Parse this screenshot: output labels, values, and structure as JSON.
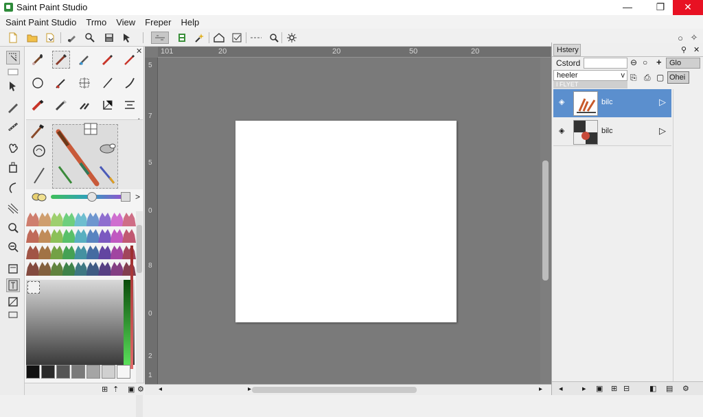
{
  "window": {
    "title": "Saint Paint Studio",
    "minimize": "—",
    "maximize": "❐",
    "close": "✕"
  },
  "menu": [
    "Saint Paint Studio",
    "Trmo",
    "View",
    "Freper",
    "Help"
  ],
  "toolbar": {
    "buttons": [
      "new-file-icon",
      "open-folder-icon",
      "import-icon",
      "brush-settings-icon",
      "zoom-tool-icon",
      "save-icon",
      "pointer-icon",
      "select-active-icon",
      "layer-icon",
      "effects-icon",
      "home-icon",
      "check-icon",
      "dots-icon",
      "search-icon",
      "settings-gear-icon"
    ],
    "right_icons": [
      "○",
      "✧"
    ]
  },
  "ruler": {
    "h_ticks": [
      "101",
      "20",
      "20",
      "50",
      "20"
    ],
    "v_ticks": [
      "5",
      "7",
      "5",
      "0",
      "8",
      "0",
      "2",
      "1"
    ]
  },
  "panel": {
    "close": "✕",
    "collapse": "^",
    "slider_arrow": ">",
    "slider_value": 0.6
  },
  "right": {
    "tab": "Hstery",
    "pin": "⚲",
    "close": "✕",
    "cstord_label": "Cstord",
    "blend_value": "",
    "opacity_value": "Glo",
    "filter_label": "heeler",
    "filter_dropdown": "v",
    "layer_group": "I FLYET",
    "opt_label": "Ohei",
    "layers": [
      {
        "name": "bilc",
        "selected": true
      },
      {
        "name": "bilc",
        "selected": false
      }
    ]
  },
  "colors": {
    "accent": "#5b8fce",
    "close_red": "#e81123",
    "canvas_bg": "#7a7a7a",
    "paper": "#ffffff"
  }
}
